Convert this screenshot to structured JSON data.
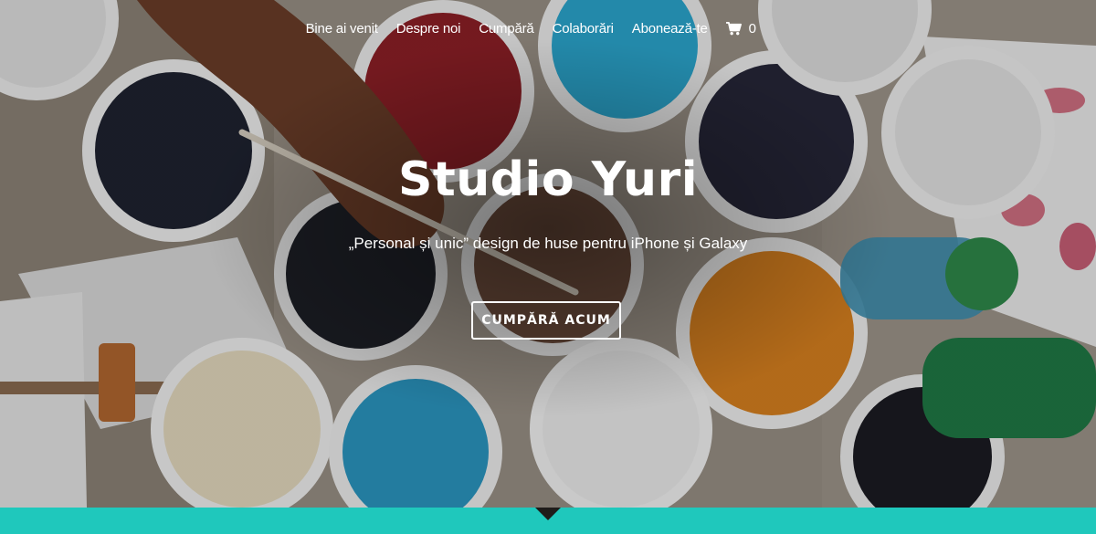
{
  "nav": {
    "items": [
      "Bine ai venit",
      "Despre noi",
      "Cumpără",
      "Colaborări",
      "Abonează-te"
    ],
    "cart_count": "0"
  },
  "hero": {
    "title": "Studio Yuri",
    "tagline": "„Personal și unic” design de huse pentru iPhone și Galaxy",
    "cta_label": "CUMPĂRĂ ACUM"
  },
  "colors": {
    "accent_band": "#1fc8bc",
    "text": "#ffffff"
  }
}
